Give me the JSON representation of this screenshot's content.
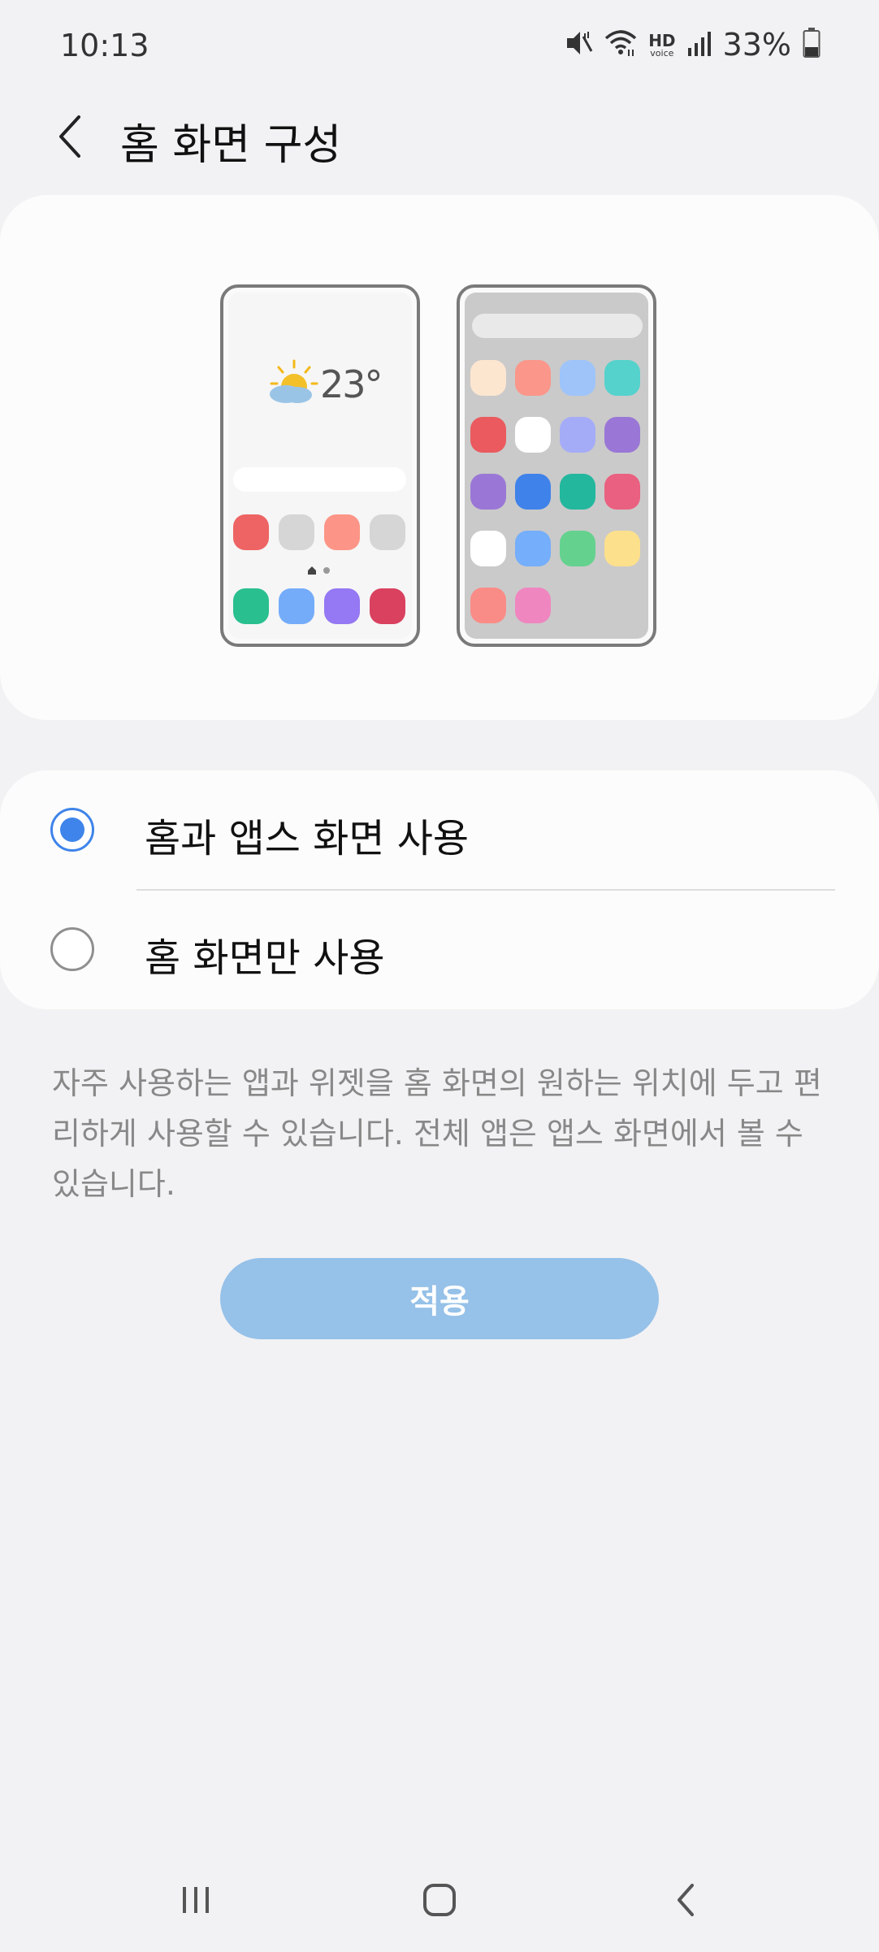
{
  "status_bar": {
    "time": "10:13",
    "battery_percent": "33%",
    "hd_label": "HD",
    "voice_label": "voice",
    "icons": [
      "vibrate-mute-icon",
      "wifi-icon",
      "hd-voice-icon",
      "signal-icon",
      "battery-icon"
    ]
  },
  "header": {
    "back_icon": "chevron-left-icon",
    "title": "홈 화면 구성"
  },
  "preview": {
    "weather_temp": "23°",
    "weather_icon": "partly-sunny-icon",
    "home_dock_colors": [
      "#ee6464",
      "#d6d6d6",
      "#fc9587",
      "#d6d6d6"
    ],
    "home_bottom_colors": [
      "#2abf8f",
      "#74acfa",
      "#9578f3",
      "#d9415f"
    ],
    "apps_grid_colors": [
      "#fde6d0",
      "#fb968a",
      "#9ec4fa",
      "#55d2cc",
      "#ea5a5e",
      "#ffffff",
      "#a5acf7",
      "#9a77d6",
      "#9a77d6",
      "#3f82ea",
      "#23b79e",
      "#ea6080",
      "#ffffff",
      "#75aefa",
      "#64d28e",
      "#fde08c",
      "#fa8c87",
      "#ef86c0"
    ]
  },
  "options": {
    "items": [
      {
        "label": "홈과 앱스 화면 사용",
        "checked": true
      },
      {
        "label": "홈 화면만 사용",
        "checked": false
      }
    ]
  },
  "description": "자주 사용하는 앱과 위젯을 홈 화면의 원하는 위치에 두고 편리하게 사용할 수 있습니다. 전체 앱은 앱스 화면에서 볼 수 있습니다.",
  "apply_button": "적용",
  "nav_bar": {
    "icons": [
      "recent-apps-icon",
      "home-icon",
      "back-icon"
    ]
  },
  "colors": {
    "accent": "#3e84ea",
    "apply_button_bg": "#96c1e8",
    "background": "#f2f2f4",
    "card": "#fcfcfc"
  }
}
